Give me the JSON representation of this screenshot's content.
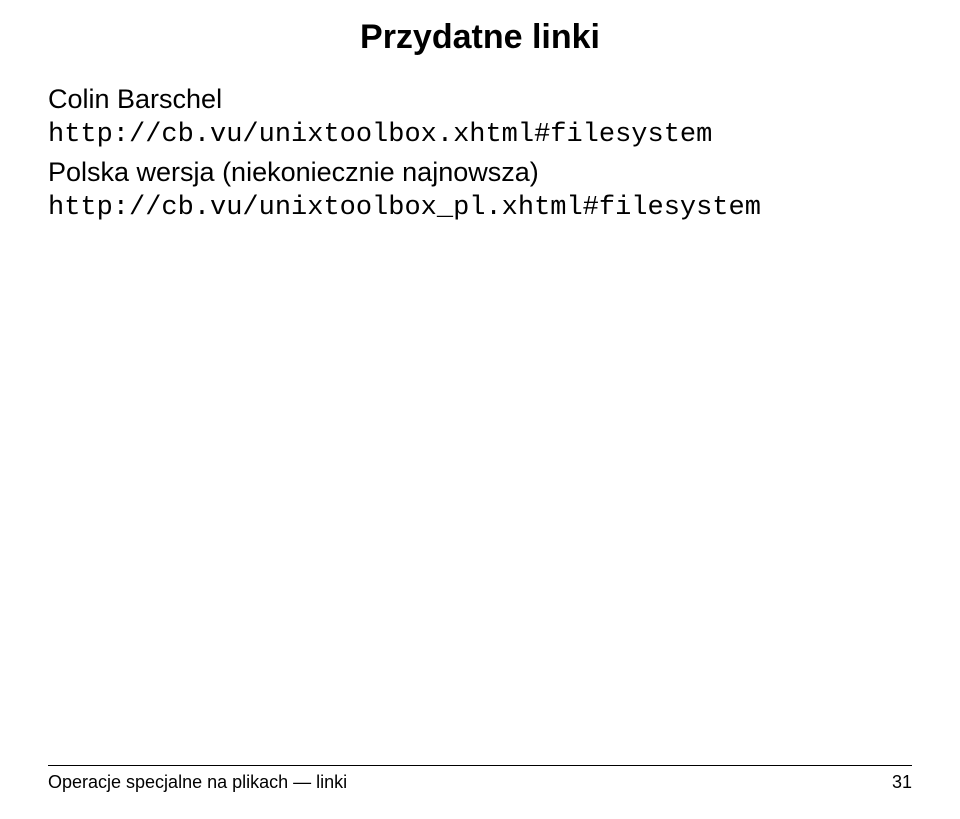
{
  "title": "Przydatne linki",
  "body": {
    "author": "Colin Barschel",
    "url1": "http://cb.vu/unixtoolbox.xhtml#filesystem",
    "note": "Polska wersja (niekoniecznie najnowsza)",
    "url2": "http://cb.vu/unixtoolbox_pl.xhtml#filesystem"
  },
  "footer": {
    "left": "Operacje specjalne na plikach — linki",
    "page": "31"
  }
}
